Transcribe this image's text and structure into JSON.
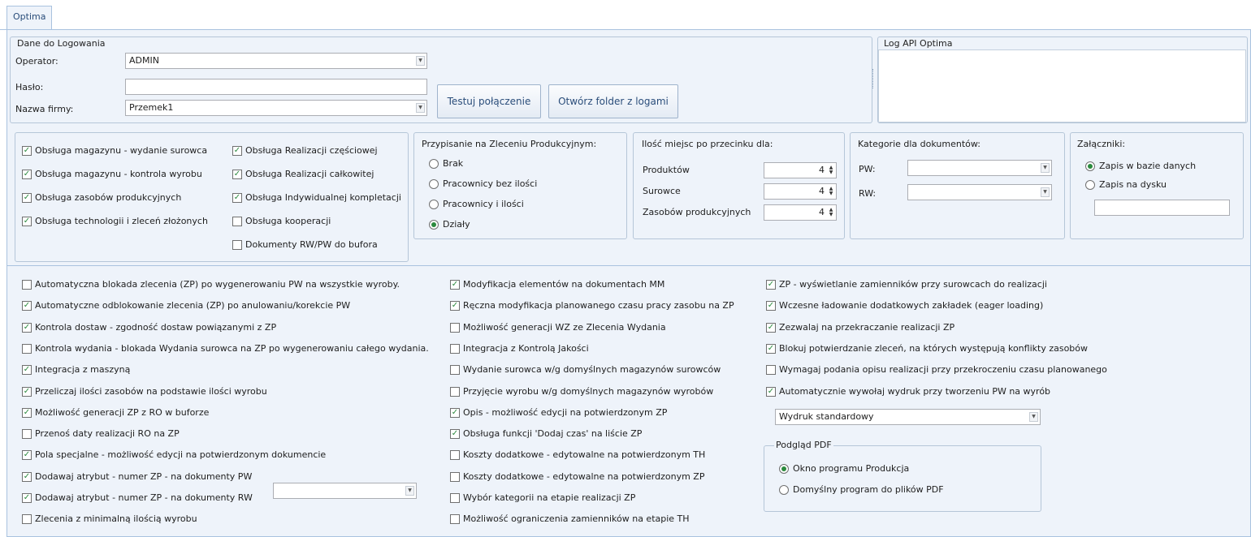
{
  "tab": {
    "label": "Optima"
  },
  "login": {
    "title": "Dane do Logowania",
    "operator_label": "Operator:",
    "operator_value": "ADMIN",
    "password_label": "Hasło:",
    "password_value": "",
    "company_label": "Nazwa firmy:",
    "company_value": "Przemek1",
    "test_button": "Testuj połączenie",
    "open_logs_button": "Otwórz folder z logami"
  },
  "log_api": {
    "title": "Log API Optima"
  },
  "modules": [
    {
      "label": "Obsługa magazynu - wydanie surowca",
      "checked": true
    },
    {
      "label": "Obsługa magazynu - kontrola wyrobu",
      "checked": true
    },
    {
      "label": "Obsługa zasobów produkcyjnych",
      "checked": true
    },
    {
      "label": "Obsługa technologii i zleceń złożonych",
      "checked": true
    },
    {
      "label": "Obsługa Realizacji częściowej",
      "checked": true
    },
    {
      "label": "Obsługa Realizacji całkowitej",
      "checked": true
    },
    {
      "label": "Obsługa Indywidualnej kompletacji",
      "checked": true
    },
    {
      "label": "Obsługa kooperacji",
      "checked": false
    },
    {
      "label": "Dokumenty RW/PW do bufora",
      "checked": false
    }
  ],
  "assignment": {
    "title": "Przypisanie na Zleceniu Produkcyjnym:",
    "options": [
      {
        "label": "Brak",
        "selected": false
      },
      {
        "label": "Pracownicy bez ilości",
        "selected": false
      },
      {
        "label": "Pracownicy i ilości",
        "selected": false
      },
      {
        "label": "Działy",
        "selected": true
      }
    ]
  },
  "decimals": {
    "title": "Ilość miejsc po przecinku dla:",
    "rows": [
      {
        "label": "Produktów",
        "value": "4"
      },
      {
        "label": "Surowce",
        "value": "4"
      },
      {
        "label": "Zasobów produkcyjnych",
        "value": "4"
      }
    ]
  },
  "categories": {
    "title": "Kategorie dla dokumentów:",
    "pw_label": "PW:",
    "pw_value": "",
    "rw_label": "RW:",
    "rw_value": ""
  },
  "attachments": {
    "title": "Załączniki:",
    "options": [
      {
        "label": "Zapis w bazie danych",
        "selected": true
      },
      {
        "label": "Zapis na dysku",
        "selected": false
      }
    ],
    "path_value": ""
  },
  "options_col1": [
    {
      "label": "Automatyczna blokada zlecenia (ZP) po wygenerowaniu PW na wszystkie wyroby.",
      "checked": false
    },
    {
      "label": "Automatyczne odblokowanie zlecenia (ZP) po anulowaniu/korekcie PW",
      "checked": true
    },
    {
      "label": "Kontrola dostaw - zgodność dostaw powiązanymi z ZP",
      "checked": true
    },
    {
      "label": "Kontrola wydania - blokada Wydania surowca na ZP po wygenerowaniu całego wydania.",
      "checked": false
    },
    {
      "label": "Integracja z maszyną",
      "checked": true
    },
    {
      "label": "Przeliczaj ilości zasobów na podstawie ilości wyrobu",
      "checked": true
    },
    {
      "label": "Możliwość generacji ZP z RO w buforze",
      "checked": true
    },
    {
      "label": "Przenoś daty realizacji RO na ZP",
      "checked": false
    },
    {
      "label": "Pola specjalne - możliwość edycji na potwierdzonym dokumencie",
      "checked": true
    },
    {
      "label": "Dodawaj atrybut - numer ZP - na dokumenty PW",
      "checked": true
    },
    {
      "label": "Dodawaj atrybut - numer ZP - na dokumenty RW",
      "checked": true
    },
    {
      "label": "Zlecenia z minimalną ilością wyrobu",
      "checked": false
    }
  ],
  "attribute_select_value": "",
  "options_col2": [
    {
      "label": "Modyfikacja elementów na dokumentach MM",
      "checked": true
    },
    {
      "label": "Ręczna modyfikacja planowanego czasu pracy zasobu  na ZP",
      "checked": true
    },
    {
      "label": "Możliwość generacji WZ ze Zlecenia Wydania",
      "checked": false
    },
    {
      "label": "Integracja z Kontrolą Jakości",
      "checked": false
    },
    {
      "label": "Wydanie surowca w/g domyślnych magazynów surowców",
      "checked": false
    },
    {
      "label": "Przyjęcie wyrobu w/g domyślnych magazynów wyrobów",
      "checked": false
    },
    {
      "label": "Opis - możliwość edycji na potwierdzonym ZP",
      "checked": true
    },
    {
      "label": "Obsługa funkcji 'Dodaj czas' na liście ZP",
      "checked": true
    },
    {
      "label": "Koszty dodatkowe - edytowalne na potwierdzonym TH",
      "checked": false
    },
    {
      "label": "Koszty dodatkowe - edytowalne na potwierdzonym ZP",
      "checked": false
    },
    {
      "label": "Wybór kategorii na etapie realizacji ZP",
      "checked": false
    },
    {
      "label": "Możliwość ograniczenia zamienników na etapie TH",
      "checked": false
    }
  ],
  "options_col3": [
    {
      "label": "ZP - wyświetlanie zamienników przy surowcach do realizacji",
      "checked": true
    },
    {
      "label": "Wczesne ładowanie dodatkowych zakładek (eager loading)",
      "checked": true
    },
    {
      "label": "Zezwalaj na przekraczanie realizacji ZP",
      "checked": true
    },
    {
      "label": "Blokuj potwierdzanie zleceń, na których występują konflikty zasobów",
      "checked": true
    },
    {
      "label": "Wymagaj podania opisu realizacji przy przekroczeniu czasu planowanego",
      "checked": false
    },
    {
      "label": "Automatycznie wywołaj wydruk przy tworzeniu PW na wyrób",
      "checked": true
    }
  ],
  "print_select_value": "Wydruk standardowy",
  "pdf_preview": {
    "title": "Podgląd PDF",
    "options": [
      {
        "label": "Okno programu Produkcja",
        "selected": true
      },
      {
        "label": "Domyślny program do plików PDF",
        "selected": false
      }
    ]
  },
  "icons": {
    "check": "✓",
    "dropdown": "chevron-down-icon",
    "spinner": "spin-updown-icon"
  },
  "colors": {
    "panel_bg": "#eef3fa",
    "border": "#a9c2df",
    "check": "#2b8a3e",
    "tab_text": "#2a4d7a"
  }
}
